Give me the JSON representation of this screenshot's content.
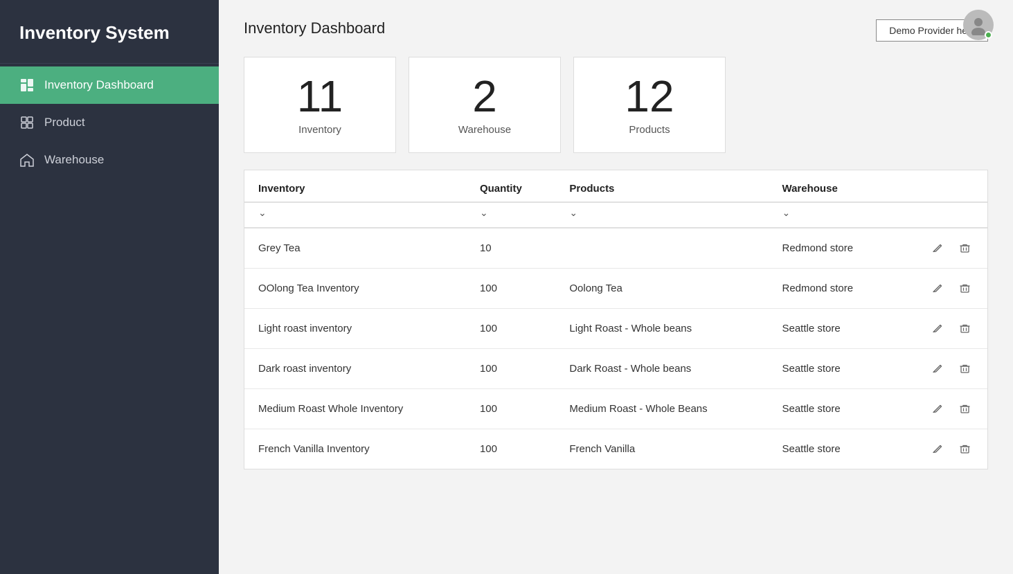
{
  "sidebar": {
    "title": "Inventory System",
    "items": [
      {
        "id": "dashboard",
        "label": "Inventory Dashboard",
        "active": true,
        "icon": "dashboard-icon"
      },
      {
        "id": "product",
        "label": "Product",
        "active": false,
        "icon": "product-icon"
      },
      {
        "id": "warehouse",
        "label": "Warehouse",
        "active": false,
        "icon": "warehouse-icon"
      }
    ]
  },
  "header": {
    "page_title": "Inventory Dashboard",
    "demo_button_label": "Demo Provider help"
  },
  "stats": [
    {
      "number": "11",
      "label": "Inventory"
    },
    {
      "number": "2",
      "label": "Warehouse"
    },
    {
      "number": "12",
      "label": "Products"
    }
  ],
  "table": {
    "columns": [
      "Inventory",
      "Quantity",
      "Products",
      "Warehouse"
    ],
    "rows": [
      {
        "inventory": "Grey Tea",
        "quantity": "10",
        "products": "",
        "warehouse": "Redmond store"
      },
      {
        "inventory": "OOlong Tea Inventory",
        "quantity": "100",
        "products": "Oolong Tea",
        "warehouse": "Redmond store"
      },
      {
        "inventory": "Light roast inventory",
        "quantity": "100",
        "products": "Light Roast - Whole beans",
        "warehouse": "Seattle store"
      },
      {
        "inventory": "Dark roast inventory",
        "quantity": "100",
        "products": "Dark Roast - Whole beans",
        "warehouse": "Seattle store"
      },
      {
        "inventory": "Medium Roast Whole Inventory",
        "quantity": "100",
        "products": "Medium Roast - Whole Beans",
        "warehouse": "Seattle store"
      },
      {
        "inventory": "French Vanilla Inventory",
        "quantity": "100",
        "products": "French Vanilla",
        "warehouse": "Seattle store"
      }
    ]
  }
}
